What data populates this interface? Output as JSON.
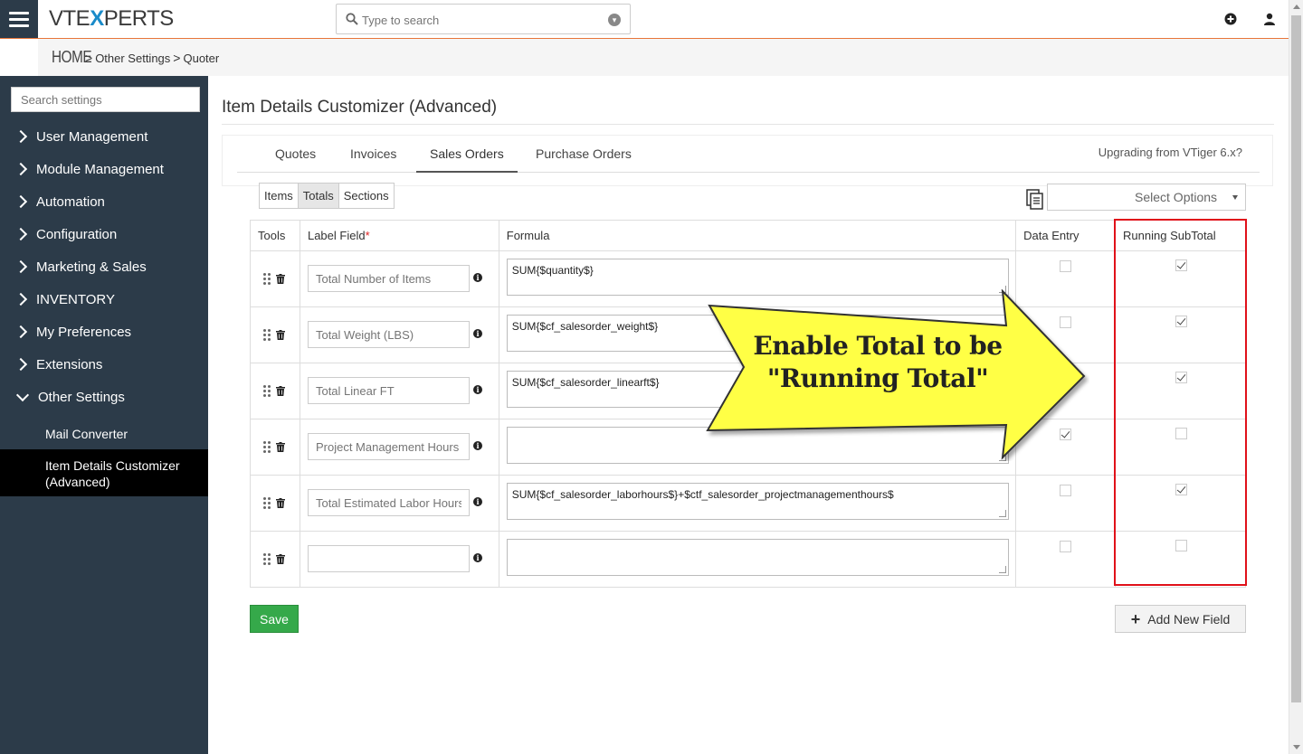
{
  "header": {
    "logo_left": "VTE",
    "logo_x": "X",
    "logo_right": "PERTS",
    "search_placeholder": "Type to search",
    "icons": [
      "menu-icon",
      "search-icon",
      "chevron-down-icon",
      "plus-circle-icon",
      "user-icon"
    ]
  },
  "breadcrumb": {
    "home": "HOME",
    "separator": ">",
    "items": [
      "Other Settings",
      "Quoter"
    ]
  },
  "sidebar": {
    "search_placeholder": "Search settings",
    "items": [
      {
        "label": "User Management"
      },
      {
        "label": "Module Management"
      },
      {
        "label": "Automation"
      },
      {
        "label": "Configuration"
      },
      {
        "label": "Marketing & Sales"
      },
      {
        "label": "INVENTORY"
      },
      {
        "label": "My Preferences"
      },
      {
        "label": "Extensions"
      },
      {
        "label": "Other Settings"
      }
    ],
    "subitems": [
      {
        "label": "Mail Converter"
      },
      {
        "label": "Item Details Customizer (Advanced)"
      }
    ]
  },
  "main": {
    "title": "Item Details Customizer (Advanced)",
    "tabs": [
      {
        "label": "Quotes"
      },
      {
        "label": "Invoices"
      },
      {
        "label": "Sales Orders"
      },
      {
        "label": "Purchase Orders"
      }
    ],
    "active_tab": "Sales Orders",
    "upgrade_link": "Upgrading from VTiger 6.x?",
    "subtabs": [
      {
        "label": "Items"
      },
      {
        "label": "Totals"
      },
      {
        "label": "Sections"
      }
    ],
    "active_subtab": "Totals",
    "select_options": "Select Options"
  },
  "table": {
    "headers": {
      "tools": "Tools",
      "label_field": "Label Field",
      "required_mark": "*",
      "formula": "Formula",
      "data_entry": "Data Entry",
      "running_subtotal": "Running SubTotal"
    },
    "rows": [
      {
        "label": "Total Number of Items",
        "formula": "SUM{$quantity$}",
        "data_entry": false,
        "running_subtotal": true
      },
      {
        "label": "Total Weight (LBS)",
        "formula": "SUM{$cf_salesorder_weight$}",
        "data_entry": false,
        "running_subtotal": true
      },
      {
        "label": "Total Linear FT",
        "formula": "SUM{$cf_salesorder_linearft$}",
        "data_entry": false,
        "running_subtotal": true
      },
      {
        "label": "Project Management Hours",
        "formula": "",
        "data_entry": true,
        "running_subtotal": false
      },
      {
        "label": "Total Estimated Labor Hours",
        "formula": "SUM{$cf_salesorder_laborhours$}+$ctf_salesorder_projectmanagementhours$",
        "data_entry": false,
        "running_subtotal": true
      },
      {
        "label": "",
        "formula": "",
        "data_entry": false,
        "running_subtotal": false
      }
    ]
  },
  "buttons": {
    "save": "Save",
    "add_new_field": "Add New Field",
    "add_icon": "+"
  },
  "callout": {
    "line1": "Enable Total to be",
    "line2": "\"Running Total\"",
    "fill_color": "#ffff44",
    "stroke_color": "#333333"
  },
  "colors": {
    "sidebar_bg": "#2c3b49",
    "accent_orange": "#e8763a",
    "save_green": "#35a94a",
    "highlight_red": "#e0111a",
    "logo_blue": "#1a8bc9"
  }
}
